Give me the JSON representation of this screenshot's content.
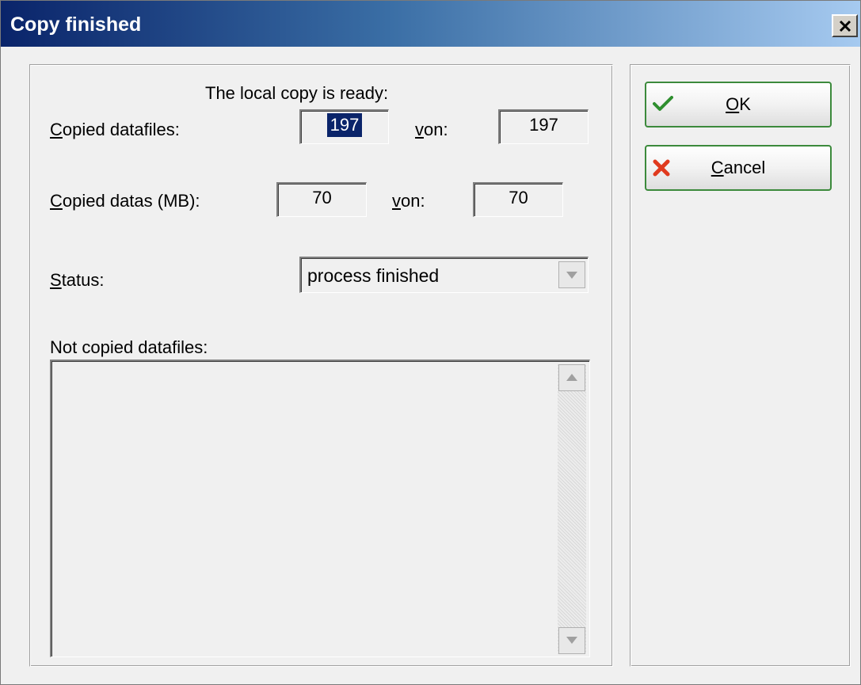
{
  "window": {
    "title": "Copy finished",
    "close_glyph": "×"
  },
  "form": {
    "heading": "The local copy is ready:",
    "copied_files": {
      "label_first": "C",
      "label_rest": "opied datafiles:",
      "value": "197",
      "of_first": "v",
      "of_rest": "on:",
      "total": "197"
    },
    "copied_data": {
      "label_first": "C",
      "label_rest": "opied datas (MB):",
      "value": "70",
      "of_first": "v",
      "of_rest": "on:",
      "total": "70"
    },
    "status": {
      "label_first": "S",
      "label_rest": "tatus:",
      "value": "process finished"
    },
    "not_copied_label": "Not copied datafiles:",
    "not_copied_items": []
  },
  "buttons": {
    "ok": {
      "label_first": "O",
      "label_rest": "K",
      "icon": "check-icon",
      "icon_color": "#2f8f2f"
    },
    "cancel": {
      "label_first": "C",
      "label_rest": "ancel",
      "icon": "x-icon",
      "icon_color": "#e03a1e"
    }
  }
}
